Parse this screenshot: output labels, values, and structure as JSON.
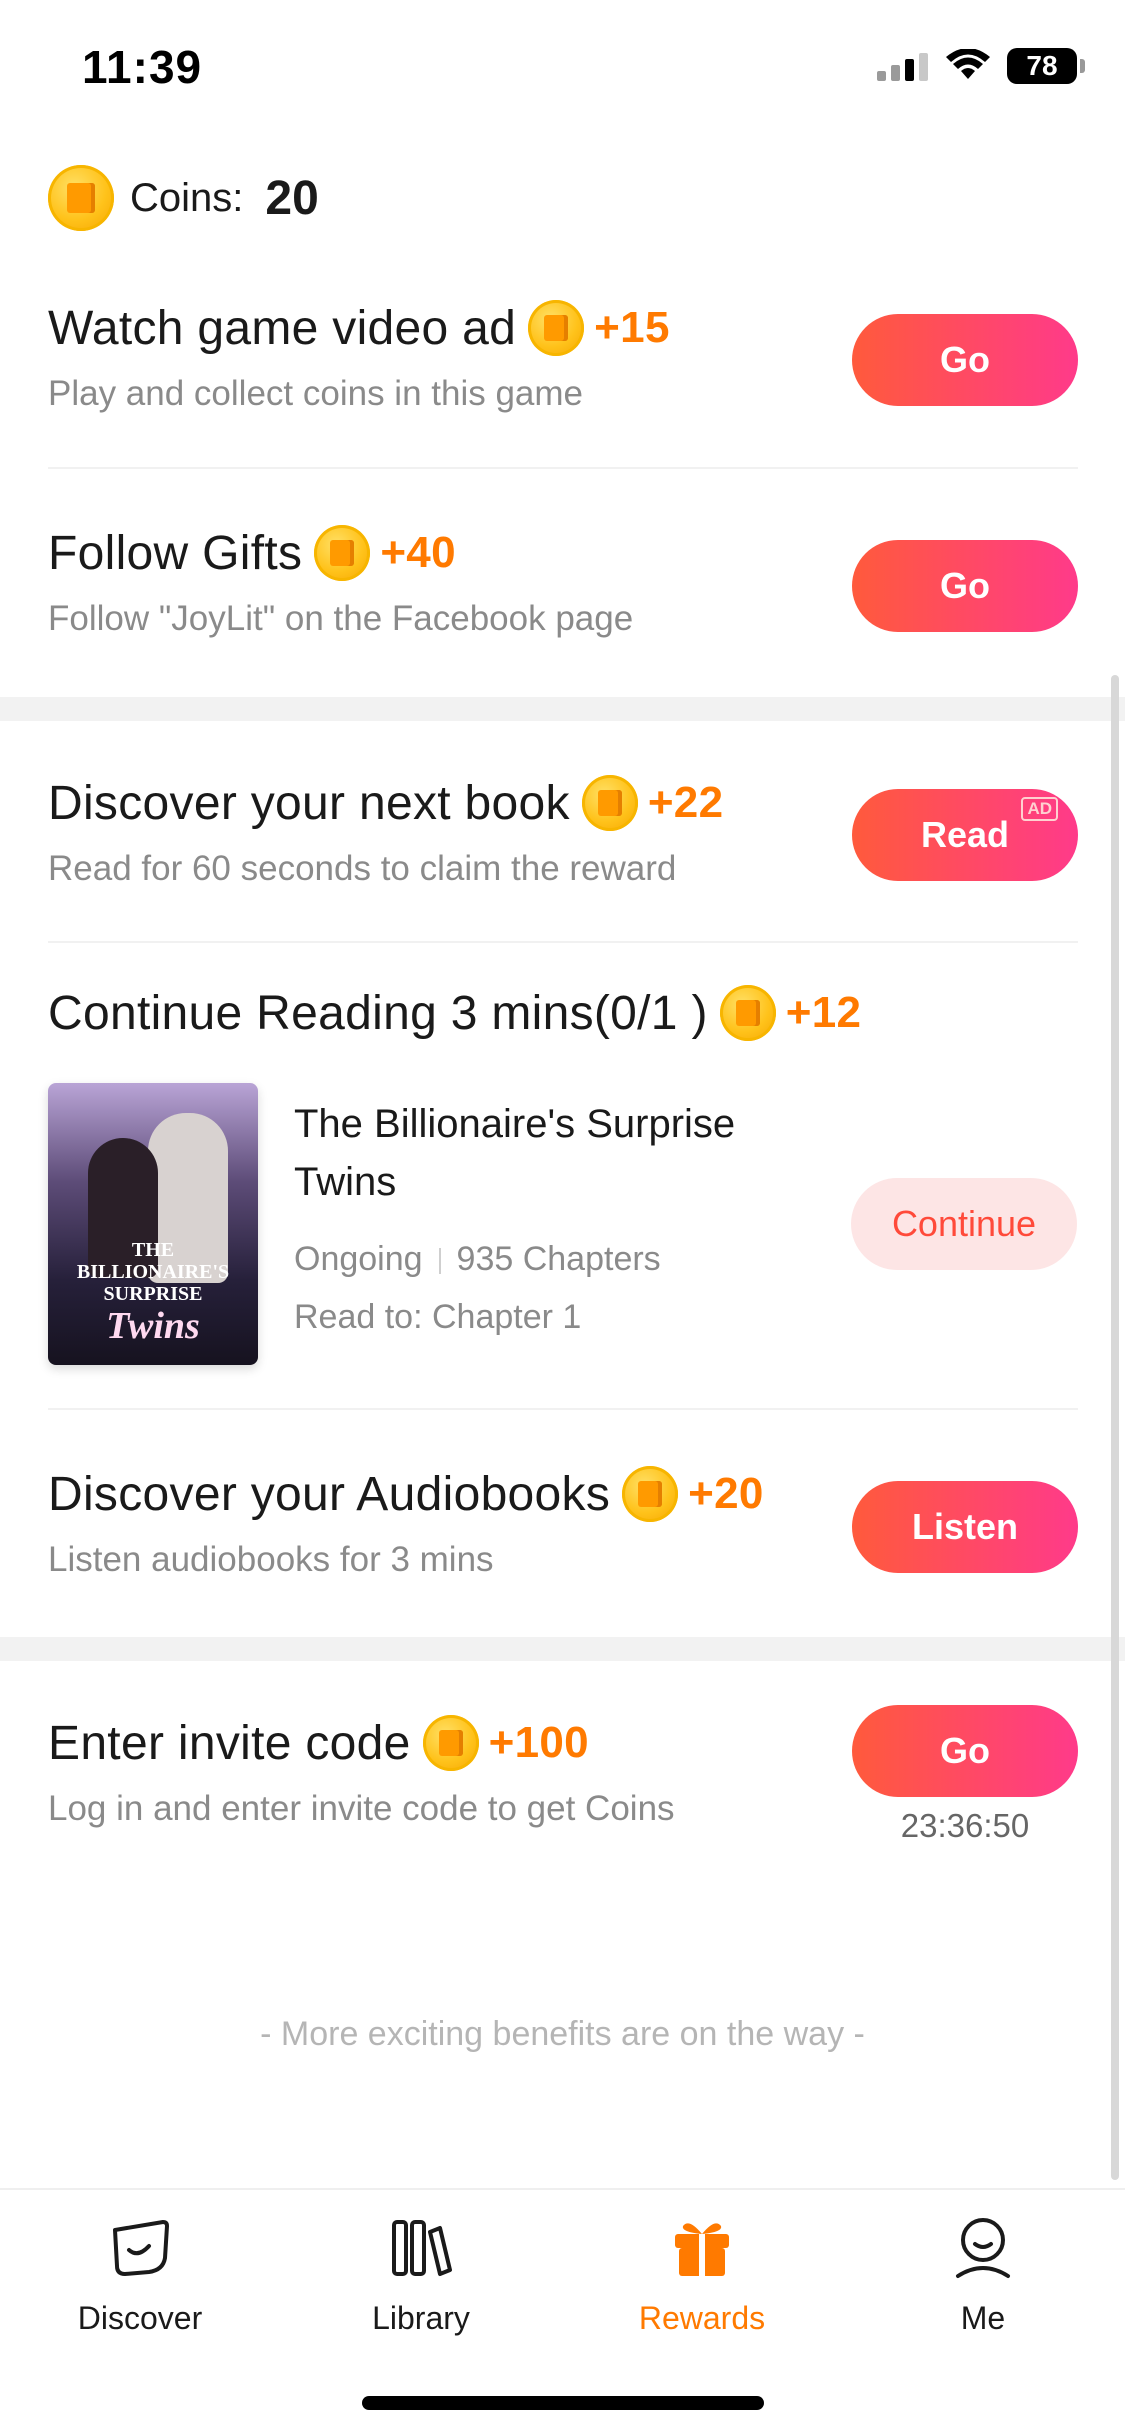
{
  "status_bar": {
    "time": "11:39",
    "battery": "78"
  },
  "coins": {
    "label": "Coins:",
    "value": "20"
  },
  "tasks": [
    {
      "title": "Watch game video ad",
      "reward": "+15",
      "subtitle": "Play and collect coins in this game",
      "button": "Go"
    },
    {
      "title": "Follow Gifts",
      "reward": "+40",
      "subtitle": "Follow \"JoyLit\" on the Facebook page",
      "button": "Go"
    },
    {
      "title": "Discover your next book",
      "reward": "+22",
      "subtitle": "Read for 60 seconds to claim the reward",
      "button": "Read",
      "badge": "AD"
    },
    {
      "title": "Continue Reading 3 mins(0/1 )",
      "reward": "+12",
      "button": "Continue"
    },
    {
      "title": "Discover your Audiobooks",
      "reward": "+20",
      "subtitle": "Listen audiobooks for 3 mins",
      "button": "Listen"
    },
    {
      "title": "Enter invite code",
      "reward": "+100",
      "subtitle": "Log in and enter invite code  to get  Coins",
      "button": "Go",
      "timer": "23:36:50"
    }
  ],
  "book": {
    "title": "The Billionaire's Surprise Twins",
    "status": "Ongoing",
    "chapters": "935 Chapters",
    "progress": "Read to: Chapter 1",
    "cover_line1": "THE",
    "cover_line2": "BILLIONAIRE'S",
    "cover_line3": "SURPRISE",
    "cover_line4": "Twins"
  },
  "footer_note": "- More exciting benefits are on the way -",
  "tabs": [
    {
      "label": "Discover",
      "icon": "discover-icon"
    },
    {
      "label": "Library",
      "icon": "library-icon"
    },
    {
      "label": "Rewards",
      "icon": "gift-icon",
      "active": true
    },
    {
      "label": "Me",
      "icon": "profile-icon"
    }
  ],
  "colors": {
    "accent": "#ff7a00",
    "button_start": "#ff5a3c",
    "button_end": "#ff3a8a",
    "continue_bg": "#fde5e5"
  }
}
